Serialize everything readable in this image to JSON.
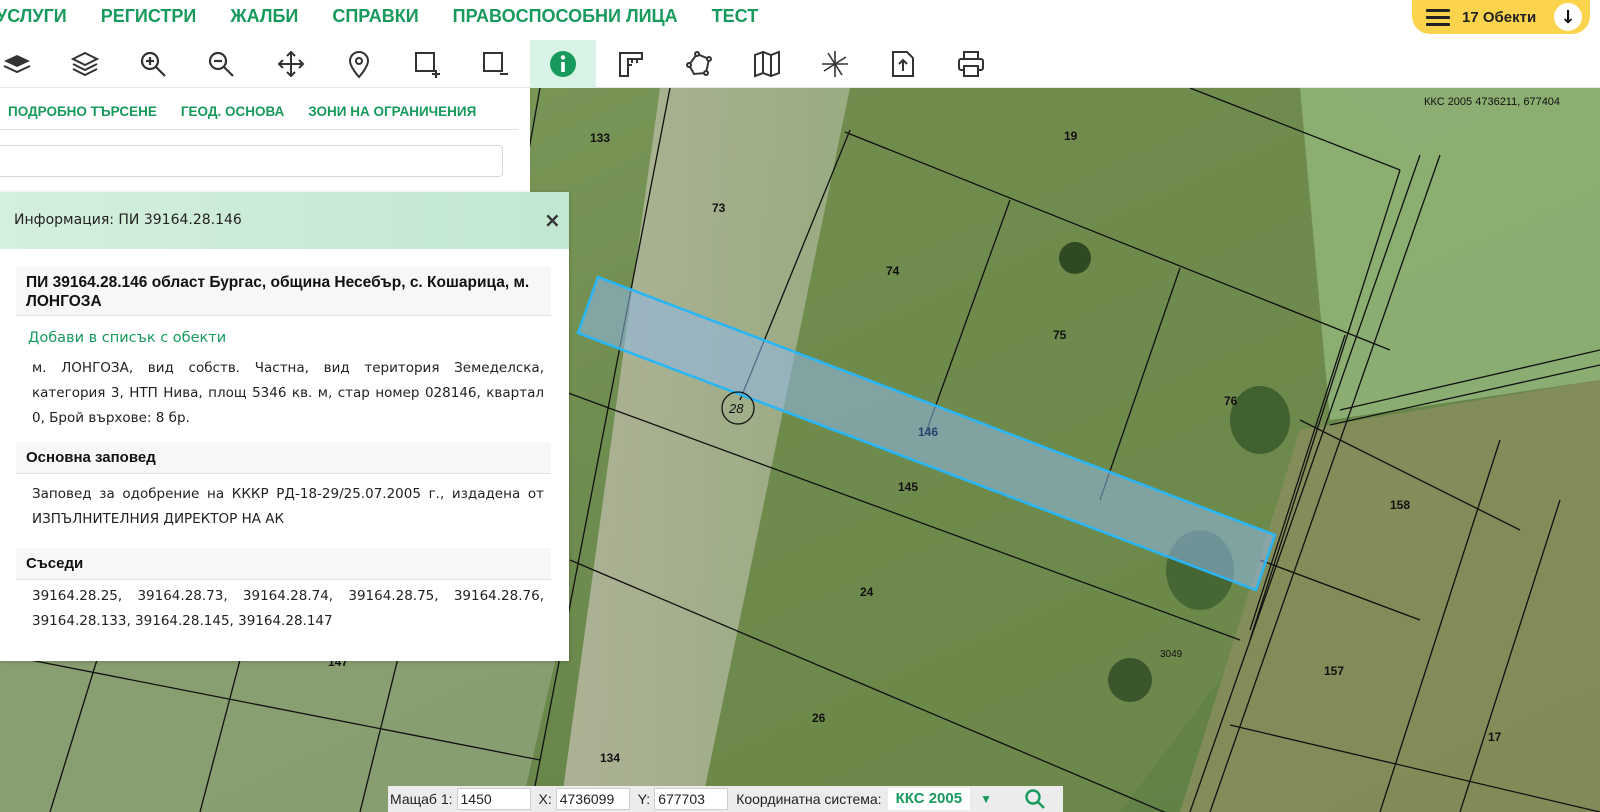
{
  "nav": {
    "items": [
      "УСЛУГИ",
      "РЕГИСТРИ",
      "ЖАЛБИ",
      "СПРАВКИ",
      "ПРАВОСПОСОБНИ ЛИЦА",
      "ТЕСТ"
    ],
    "objects_button": "17 Обекти"
  },
  "toolbar": {
    "tools": [
      "layers-filled-icon",
      "layers-icon",
      "zoom-in-icon",
      "zoom-out-icon",
      "pan-icon",
      "location-pin-icon",
      "select-rectangle-add-icon",
      "select-rectangle-remove-icon",
      "info-icon",
      "measure-icon",
      "polygon-icon",
      "map-icon",
      "crosshair-icon",
      "export-icon",
      "print-icon"
    ],
    "active": "info-icon"
  },
  "side_tabs": [
    "ПОДРОБНО ТЪРСЕНЕ",
    "ГЕОД. ОСНОВА",
    "ЗОНИ НА ОГРАНИЧЕНИЯ"
  ],
  "search": {
    "value": "",
    "placeholder": ""
  },
  "map": {
    "coords_label": "ККС 2005 4736211, 677404",
    "parcel_labels": [
      "133",
      "73",
      "19",
      "74",
      "75",
      "76",
      "146",
      "145",
      "158",
      "24",
      "157",
      "26",
      "17",
      "134",
      "147",
      "3049"
    ],
    "quarter_label": "28",
    "highlight_color": "#29b6f6"
  },
  "popup": {
    "title": "Информация: ПИ 39164.28.146",
    "heading": "ПИ 39164.28.146 област Бургас, община Несебър, с. Кошарица, м. ЛОНГОЗА",
    "add_link": "Добави в списък с обекти",
    "details": "м. ЛОНГОЗА, вид собств. Частна, вид територия Земеделска, категория 3, НТП Нива, площ 5346 кв. м, стар номер 028146, квартал 0, Брой върхове: 8 бр.",
    "order_heading": "Основна заповед",
    "order_text": "Заповед за одобрение на КККР РД-18-29/25.07.2005 г., издадена от ИЗПЪЛНИТЕЛНИЯ ДИРЕКТОР НА АК",
    "neighbors_heading": "Съседи",
    "neighbors_text": "39164.28.25, 39164.28.73, 39164.28.74, 39164.28.75, 39164.28.76, 39164.28.133, 39164.28.145, 39164.28.147"
  },
  "status": {
    "scale_label": "Мащаб 1:",
    "scale_value": "1450",
    "x_label": "X:",
    "x_value": "4736099",
    "y_label": "Y:",
    "y_value": "677703",
    "crs_label": "Координатна система:",
    "crs_value": "ККС 2005"
  },
  "colors": {
    "brand_green": "#179a5c",
    "objects_yellow": "#fcd34d",
    "active_tool": "#d9f2e6"
  }
}
